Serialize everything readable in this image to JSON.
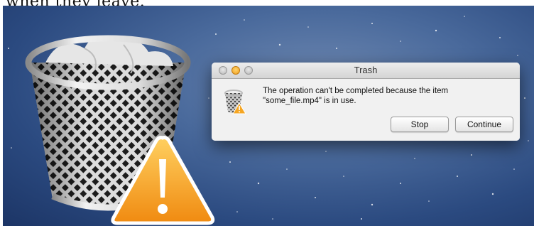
{
  "caption": "when they leave.",
  "dialog": {
    "title": "Trash",
    "message": "The operation can't be completed because the item\n\"some_file.mp4\" is in use.",
    "buttons": {
      "stop": "Stop",
      "continue": "Continue"
    }
  },
  "colors": {
    "desktop_blue": "#2b4a80",
    "warning_orange": "#f5a623",
    "minimize_yellow": "#f0a020"
  },
  "icons": [
    "trash-can-icon",
    "warning-triangle-icon",
    "trash-alert-icon"
  ]
}
